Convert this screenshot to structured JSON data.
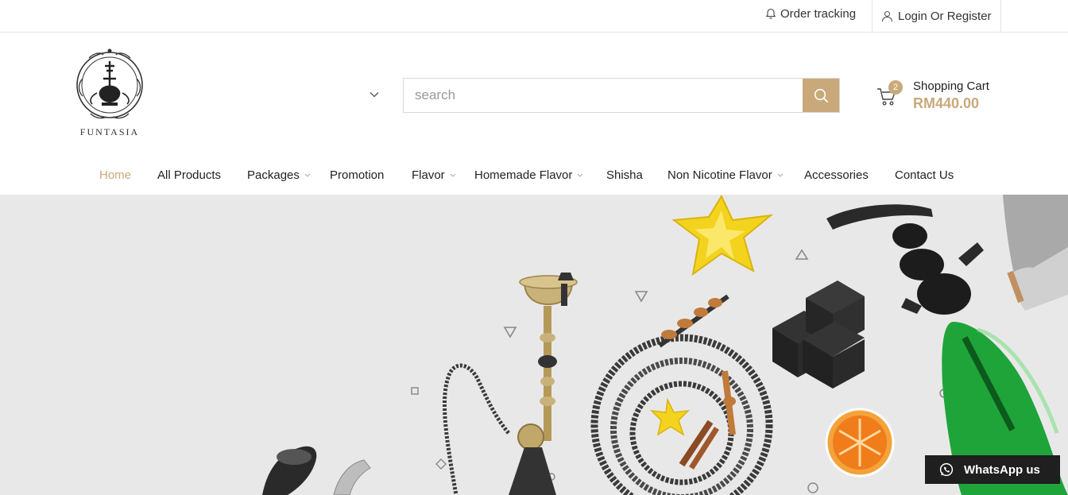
{
  "topbar": {
    "order_tracking": "Order tracking",
    "login": "Login Or Register"
  },
  "brand": {
    "name": "FUNTASIA"
  },
  "search": {
    "placeholder": "search"
  },
  "cart": {
    "label": "Shopping Cart",
    "count": "2",
    "total": "RM440.00"
  },
  "nav": {
    "items": [
      {
        "label": "Home",
        "active": true
      },
      {
        "label": "All Products"
      },
      {
        "label": "Packages",
        "dropdown": true
      },
      {
        "label": "Promotion"
      },
      {
        "label": "Flavor",
        "dropdown": true
      },
      {
        "label": "Homemade Flavor",
        "dropdown": true
      },
      {
        "label": "Shisha"
      },
      {
        "label": "Non Nicotine Flavor",
        "dropdown": true
      },
      {
        "label": "Accessories"
      },
      {
        "label": "Contact Us"
      }
    ]
  },
  "whatsapp": {
    "label": "WhatsApp us"
  },
  "colors": {
    "accent": "#c9a97a",
    "hero_bg": "#e9e8e9",
    "whatsapp_bg": "#1f1f1f"
  }
}
